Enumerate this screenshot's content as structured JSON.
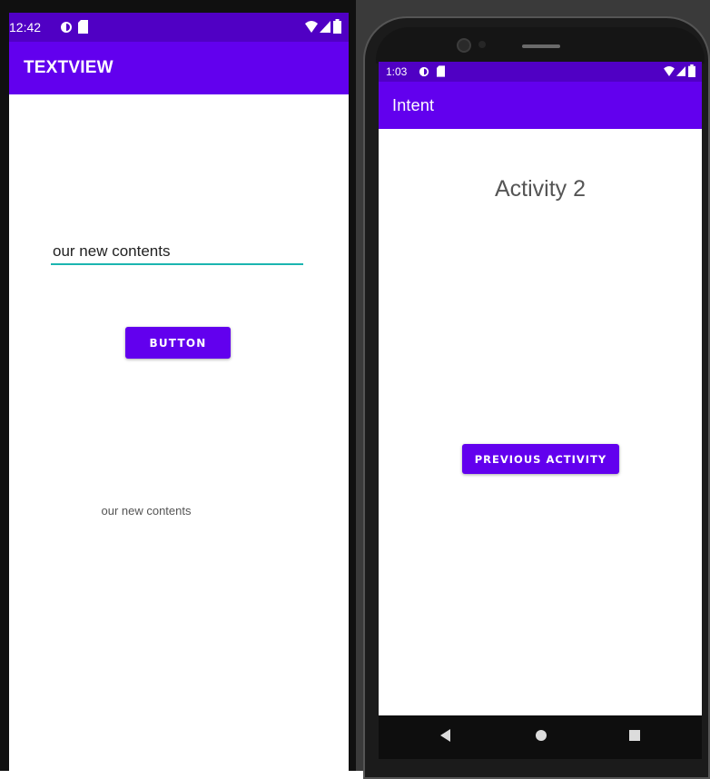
{
  "colors": {
    "status_bar": "#5000c4",
    "primary": "#6200ee",
    "edit_underline": "#1bb5b0"
  },
  "left_phone": {
    "status_bar": {
      "time": "12:42",
      "icons": [
        "sync-icon",
        "sd-card-icon",
        "wifi-icon",
        "signal-icon",
        "battery-icon"
      ]
    },
    "app_bar": {
      "title": "TEXTVIEW"
    },
    "edit_text": {
      "value": "our new contents"
    },
    "button": {
      "label": "BUTTON"
    },
    "text_view": {
      "text": "our new contents"
    }
  },
  "right_phone": {
    "status_bar": {
      "time": "1:03",
      "icons": [
        "sync-icon",
        "sd-card-icon",
        "wifi-icon",
        "signal-icon",
        "battery-icon"
      ]
    },
    "app_bar": {
      "title": "Intent"
    },
    "activity_title": "Activity 2",
    "previous_button": {
      "label": "PREVIOUS ACTIVITY"
    },
    "nav_bar": {
      "icons": [
        "back-icon",
        "home-icon",
        "recents-icon"
      ]
    }
  }
}
